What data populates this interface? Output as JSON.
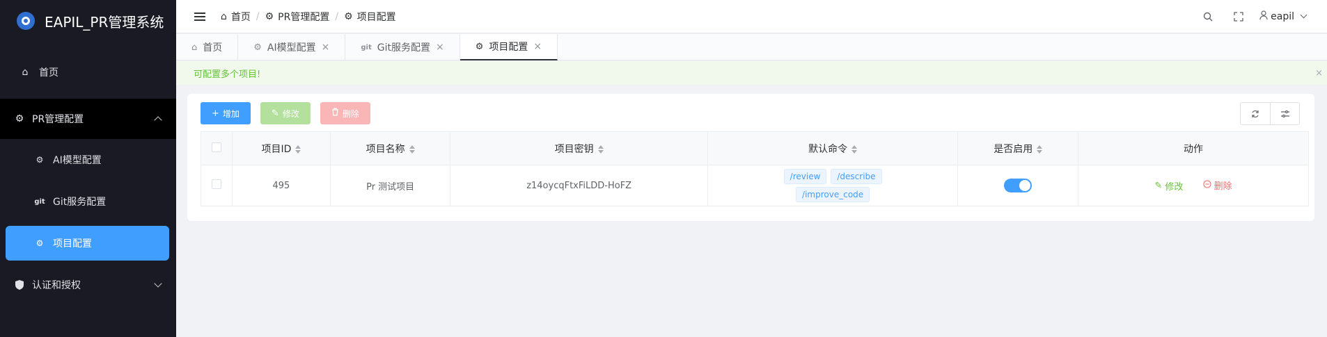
{
  "app": {
    "title": "EAPIL_PR管理系统"
  },
  "sidebar": {
    "home": "首页",
    "pr_group": "PR管理配置",
    "pr_items": [
      {
        "label": "AI模型配置",
        "icon": "gear-icon"
      },
      {
        "label": "Git服务配置",
        "icon": "git-icon"
      },
      {
        "label": "项目配置",
        "icon": "gear-icon",
        "active": true
      }
    ],
    "auth_group": "认证和授权"
  },
  "header": {
    "breadcrumb": [
      "首页",
      "PR管理配置",
      "项目配置"
    ],
    "user": "eapil"
  },
  "tabs": [
    {
      "label": "首页",
      "icon": "home-icon",
      "closable": false
    },
    {
      "label": "AI模型配置",
      "icon": "gear-icon",
      "closable": true
    },
    {
      "label": "Git服务配置",
      "icon": "git-icon",
      "closable": true
    },
    {
      "label": "项目配置",
      "icon": "gear-icon",
      "closable": true,
      "active": true
    }
  ],
  "alert": {
    "text": "可配置多个项目!"
  },
  "toolbar": {
    "add": "增加",
    "edit": "修改",
    "delete": "删除"
  },
  "table": {
    "headers": [
      "项目ID",
      "项目名称",
      "项目密钥",
      "默认命令",
      "是否启用",
      "动作"
    ],
    "rows": [
      {
        "id": "495",
        "name": "Pr 测试项目",
        "key": "z14oycqFtxFiLDD-HoFZ",
        "commands": [
          "/review",
          "/describe",
          "/improve_code"
        ],
        "enabled": true,
        "edit": "修改",
        "delete": "删除"
      }
    ]
  },
  "colors": {
    "primary": "#409eff",
    "sidebar_bg": "#191a23",
    "success": "#67c23a",
    "danger": "#f56c6c"
  }
}
